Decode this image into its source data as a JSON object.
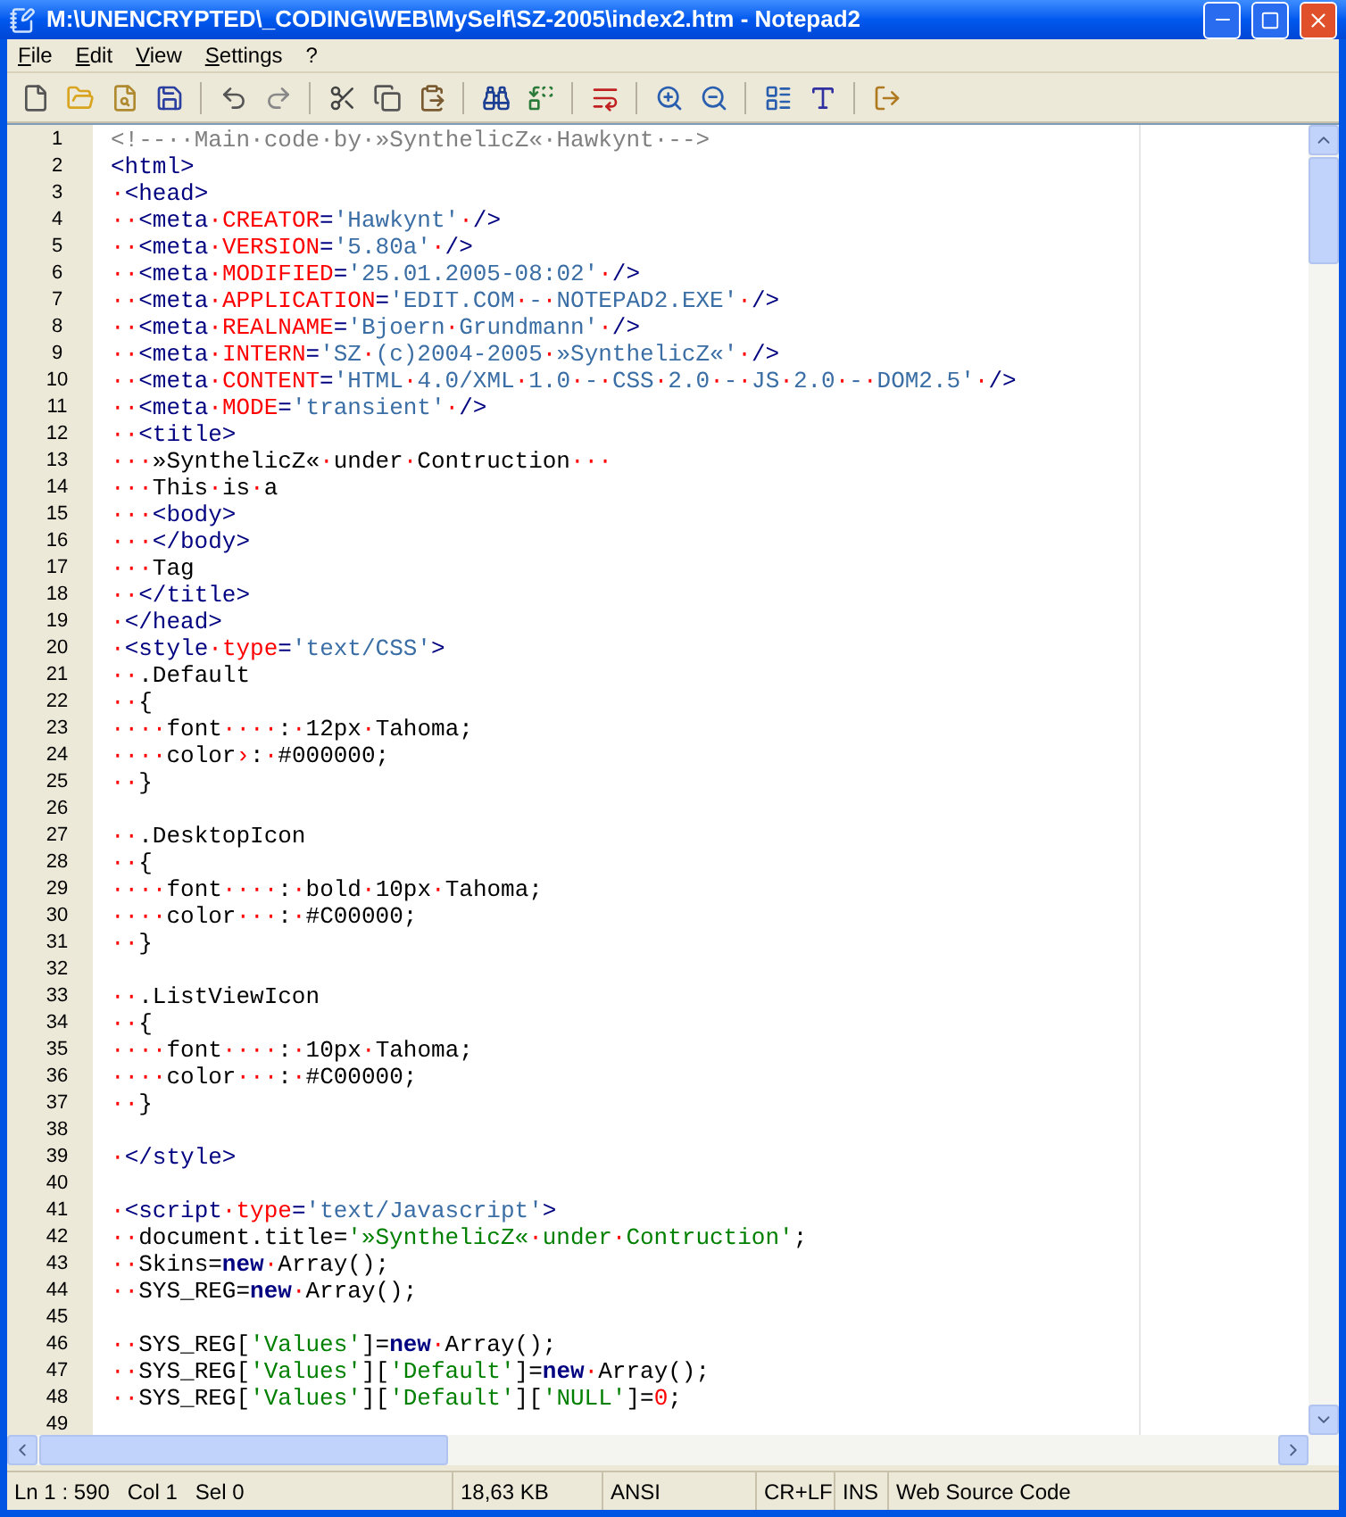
{
  "window": {
    "title": "M:\\UNENCRYPTED\\_CODING\\WEB\\MySelf\\SZ-2005\\index2.htm - Notepad2"
  },
  "menu": [
    "File",
    "Edit",
    "View",
    "Settings",
    "?"
  ],
  "editor": {
    "lines": [
      {
        "number": "1",
        "tokens": [
          {
            "kind": "comment",
            "text": "<!--··Main·code·by·»SynthelicZ«·Hawkynt·-->"
          }
        ]
      },
      {
        "number": "2",
        "tokens": [
          {
            "kind": "tag",
            "text": "<html>"
          }
        ]
      },
      {
        "number": "3",
        "tokens": [
          {
            "kind": "plain",
            "text": "·"
          },
          {
            "kind": "tag",
            "text": "<head>"
          }
        ]
      },
      {
        "number": "4",
        "tokens": [
          {
            "kind": "plain",
            "text": "··"
          },
          {
            "kind": "tag",
            "text": "<meta·"
          },
          {
            "kind": "attr",
            "text": "CREATOR"
          },
          {
            "kind": "tag",
            "text": "="
          },
          {
            "kind": "value",
            "text": "'Hawkynt'"
          },
          {
            "kind": "tag",
            "text": "·/>"
          }
        ]
      },
      {
        "number": "5",
        "tokens": [
          {
            "kind": "plain",
            "text": "··"
          },
          {
            "kind": "tag",
            "text": "<meta·"
          },
          {
            "kind": "attr",
            "text": "VERSION"
          },
          {
            "kind": "tag",
            "text": "="
          },
          {
            "kind": "value",
            "text": "'5.80a'"
          },
          {
            "kind": "tag",
            "text": "·/>"
          }
        ]
      },
      {
        "number": "6",
        "tokens": [
          {
            "kind": "plain",
            "text": "··"
          },
          {
            "kind": "tag",
            "text": "<meta·"
          },
          {
            "kind": "attr",
            "text": "MODIFIED"
          },
          {
            "kind": "tag",
            "text": "="
          },
          {
            "kind": "value",
            "text": "'25.01.2005-08:02'"
          },
          {
            "kind": "tag",
            "text": "·/>"
          }
        ]
      },
      {
        "number": "7",
        "tokens": [
          {
            "kind": "plain",
            "text": "··"
          },
          {
            "kind": "tag",
            "text": "<meta·"
          },
          {
            "kind": "attr",
            "text": "APPLICATION"
          },
          {
            "kind": "tag",
            "text": "="
          },
          {
            "kind": "value",
            "text": "'EDIT.COM·-·NOTEPAD2.EXE'"
          },
          {
            "kind": "tag",
            "text": "·/>"
          }
        ]
      },
      {
        "number": "8",
        "tokens": [
          {
            "kind": "plain",
            "text": "··"
          },
          {
            "kind": "tag",
            "text": "<meta·"
          },
          {
            "kind": "attr",
            "text": "REALNAME"
          },
          {
            "kind": "tag",
            "text": "="
          },
          {
            "kind": "value",
            "text": "'Bjoern·Grundmann'"
          },
          {
            "kind": "tag",
            "text": "·/>"
          }
        ]
      },
      {
        "number": "9",
        "tokens": [
          {
            "kind": "plain",
            "text": "··"
          },
          {
            "kind": "tag",
            "text": "<meta·"
          },
          {
            "kind": "attr",
            "text": "INTERN"
          },
          {
            "kind": "tag",
            "text": "="
          },
          {
            "kind": "value",
            "text": "'SZ·(c)2004-2005·»SynthelicZ«'"
          },
          {
            "kind": "tag",
            "text": "·/>"
          }
        ]
      },
      {
        "number": "10",
        "tokens": [
          {
            "kind": "plain",
            "text": "··"
          },
          {
            "kind": "tag",
            "text": "<meta·"
          },
          {
            "kind": "attr",
            "text": "CONTENT"
          },
          {
            "kind": "tag",
            "text": "="
          },
          {
            "kind": "value",
            "text": "'HTML·4.0/XML·1.0·-·CSS·2.0·-·JS·2.0·-·DOM2.5'"
          },
          {
            "kind": "tag",
            "text": "·/>"
          }
        ]
      },
      {
        "number": "11",
        "tokens": [
          {
            "kind": "plain",
            "text": "··"
          },
          {
            "kind": "tag",
            "text": "<meta·"
          },
          {
            "kind": "attr",
            "text": "MODE"
          },
          {
            "kind": "tag",
            "text": "="
          },
          {
            "kind": "value",
            "text": "'transient'"
          },
          {
            "kind": "tag",
            "text": "·/>"
          }
        ]
      },
      {
        "number": "12",
        "tokens": [
          {
            "kind": "plain",
            "text": "··"
          },
          {
            "kind": "tag",
            "text": "<title>"
          }
        ]
      },
      {
        "number": "13",
        "tokens": [
          {
            "kind": "plain",
            "text": "···»SynthelicZ«·under·Contruction···"
          }
        ]
      },
      {
        "number": "14",
        "tokens": [
          {
            "kind": "plain",
            "text": "···This·is·a"
          }
        ]
      },
      {
        "number": "15",
        "tokens": [
          {
            "kind": "plain",
            "text": "···"
          },
          {
            "kind": "tag",
            "text": "<body>"
          }
        ]
      },
      {
        "number": "16",
        "tokens": [
          {
            "kind": "plain",
            "text": "···"
          },
          {
            "kind": "tag",
            "text": "</body>"
          }
        ]
      },
      {
        "number": "17",
        "tokens": [
          {
            "kind": "plain",
            "text": "···Tag"
          }
        ]
      },
      {
        "number": "18",
        "tokens": [
          {
            "kind": "plain",
            "text": "··"
          },
          {
            "kind": "tag",
            "text": "</title>"
          }
        ]
      },
      {
        "number": "19",
        "tokens": [
          {
            "kind": "plain",
            "text": "·"
          },
          {
            "kind": "tag",
            "text": "</head>"
          }
        ]
      },
      {
        "number": "20",
        "tokens": [
          {
            "kind": "plain",
            "text": "·"
          },
          {
            "kind": "tag",
            "text": "<style·"
          },
          {
            "kind": "attr",
            "text": "type"
          },
          {
            "kind": "tag",
            "text": "="
          },
          {
            "kind": "value",
            "text": "'text/CSS'"
          },
          {
            "kind": "tag",
            "text": ">"
          }
        ]
      },
      {
        "number": "21",
        "tokens": [
          {
            "kind": "plain",
            "text": "··.Default"
          }
        ]
      },
      {
        "number": "22",
        "tokens": [
          {
            "kind": "plain",
            "text": "··{"
          }
        ]
      },
      {
        "number": "23",
        "tokens": [
          {
            "kind": "plain",
            "text": "····font····:·12px·Tahoma;"
          }
        ]
      },
      {
        "number": "24",
        "tokens": [
          {
            "kind": "plain",
            "text": "····color"
          },
          {
            "kind": "tab",
            "text": "›"
          },
          {
            "kind": "plain",
            "text": ":·#000000;"
          }
        ]
      },
      {
        "number": "25",
        "tokens": [
          {
            "kind": "plain",
            "text": "··}"
          }
        ]
      },
      {
        "number": "26"
      },
      {
        "number": "27",
        "tokens": [
          {
            "kind": "plain",
            "text": "··.DesktopIcon"
          }
        ]
      },
      {
        "number": "28",
        "tokens": [
          {
            "kind": "plain",
            "text": "··{"
          }
        ]
      },
      {
        "number": "29",
        "tokens": [
          {
            "kind": "plain",
            "text": "····font····:·bold·10px·Tahoma;"
          }
        ]
      },
      {
        "number": "30",
        "tokens": [
          {
            "kind": "plain",
            "text": "····color···:·#C00000;"
          }
        ]
      },
      {
        "number": "31",
        "tokens": [
          {
            "kind": "plain",
            "text": "··}"
          }
        ]
      },
      {
        "number": "32"
      },
      {
        "number": "33",
        "tokens": [
          {
            "kind": "plain",
            "text": "··.ListViewIcon"
          }
        ]
      },
      {
        "number": "34",
        "tokens": [
          {
            "kind": "plain",
            "text": "··{"
          }
        ]
      },
      {
        "number": "35",
        "tokens": [
          {
            "kind": "plain",
            "text": "····font····:·10px·Tahoma;"
          }
        ]
      },
      {
        "number": "36",
        "tokens": [
          {
            "kind": "plain",
            "text": "····color···:·#C00000;"
          }
        ]
      },
      {
        "number": "37",
        "tokens": [
          {
            "kind": "plain",
            "text": "··}"
          }
        ]
      },
      {
        "number": "38"
      },
      {
        "number": "39",
        "tokens": [
          {
            "kind": "plain",
            "text": "·"
          },
          {
            "kind": "tag",
            "text": "</style>"
          }
        ]
      },
      {
        "number": "40"
      },
      {
        "number": "41",
        "tokens": [
          {
            "kind": "plain",
            "text": "·"
          },
          {
            "kind": "tag",
            "text": "<script·"
          },
          {
            "kind": "attr",
            "text": "type"
          },
          {
            "kind": "tag",
            "text": "="
          },
          {
            "kind": "value",
            "text": "'text/Javascript'"
          },
          {
            "kind": "tag",
            "text": ">"
          }
        ]
      },
      {
        "number": "42",
        "tokens": [
          {
            "kind": "plain",
            "text": "··document.title="
          },
          {
            "kind": "string",
            "text": "'»SynthelicZ«·under·Contruction'"
          },
          {
            "kind": "plain",
            "text": ";"
          }
        ]
      },
      {
        "number": "43",
        "tokens": [
          {
            "kind": "plain",
            "text": "··Skins="
          },
          {
            "kind": "keyword",
            "text": "new"
          },
          {
            "kind": "plain",
            "text": "·Array();"
          }
        ]
      },
      {
        "number": "44",
        "tokens": [
          {
            "kind": "plain",
            "text": "··SYS_REG="
          },
          {
            "kind": "keyword",
            "text": "new"
          },
          {
            "kind": "plain",
            "text": "·Array();"
          }
        ]
      },
      {
        "number": "45"
      },
      {
        "number": "46",
        "tokens": [
          {
            "kind": "plain",
            "text": "··SYS_REG["
          },
          {
            "kind": "string",
            "text": "'Values'"
          },
          {
            "kind": "plain",
            "text": "]="
          },
          {
            "kind": "keyword",
            "text": "new"
          },
          {
            "kind": "plain",
            "text": "·Array();"
          }
        ]
      },
      {
        "number": "47",
        "tokens": [
          {
            "kind": "plain",
            "text": "··SYS_REG["
          },
          {
            "kind": "string",
            "text": "'Values'"
          },
          {
            "kind": "plain",
            "text": "]["
          },
          {
            "kind": "string",
            "text": "'Default'"
          },
          {
            "kind": "plain",
            "text": "]="
          },
          {
            "kind": "keyword",
            "text": "new"
          },
          {
            "kind": "plain",
            "text": "·Array();"
          }
        ]
      },
      {
        "number": "48",
        "tokens": [
          {
            "kind": "plain",
            "text": "··SYS_REG["
          },
          {
            "kind": "string",
            "text": "'Values'"
          },
          {
            "kind": "plain",
            "text": "]["
          },
          {
            "kind": "string",
            "text": "'Default'"
          },
          {
            "kind": "plain",
            "text": "]["
          },
          {
            "kind": "string",
            "text": "'NULL'"
          },
          {
            "kind": "plain",
            "text": "]="
          },
          {
            "kind": "number",
            "text": "0"
          },
          {
            "kind": "plain",
            "text": ";"
          }
        ]
      },
      {
        "number": "49"
      }
    ]
  },
  "status_bar": [
    {
      "texts": [
        "Ln 1 : 590",
        "Col 1",
        "Sel 0"
      ]
    },
    {
      "texts": [
        "18,63 KB"
      ]
    },
    {
      "texts": [
        "ANSI"
      ]
    },
    {
      "texts": [
        "CR+LF"
      ]
    },
    {
      "texts": [
        "INS"
      ]
    },
    {
      "texts": [
        "Web Source Code"
      ]
    }
  ]
}
